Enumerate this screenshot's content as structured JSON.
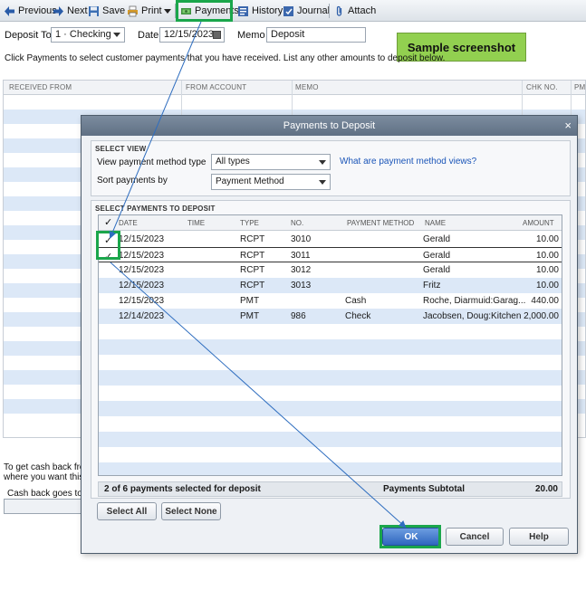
{
  "toolbar": {
    "previous": "Previous",
    "next": "Next",
    "save": "Save",
    "print": "Print",
    "payments": "Payments",
    "history": "History",
    "journal": "Journal",
    "attach": "Attach"
  },
  "deposit": {
    "deposit_to_label": "Deposit To",
    "deposit_to_value": "1 · Checking",
    "date_label": "Date",
    "date_value": "12/15/2023",
    "memo_label": "Memo",
    "memo_value": "Deposit",
    "instructions": "Click Payments to select customer payments that you have received. List any other amounts to deposit below."
  },
  "sample_label": "Sample screenshot",
  "background_table": {
    "columns": [
      "RECEIVED FROM",
      "FROM ACCOUNT",
      "MEMO",
      "CHK NO.",
      "PMT"
    ]
  },
  "bottom": {
    "line1": "To get cash back from",
    "line2": "where you want this m",
    "cash_back": "Cash back goes to"
  },
  "dialog": {
    "title": "Payments to Deposit",
    "select_view": {
      "title": "SELECT VIEW",
      "method_label": "View payment method type",
      "method_value": "All types",
      "sort_label": "Sort payments by",
      "sort_value": "Payment Method",
      "help_link": "What are payment method views?"
    },
    "select_payments": {
      "title": "SELECT PAYMENTS TO DEPOSIT",
      "columns": {
        "check": "✓",
        "date": "DATE",
        "time": "TIME",
        "type": "TYPE",
        "no": "NO.",
        "method": "PAYMENT METHOD",
        "name": "NAME",
        "amount": "AMOUNT"
      },
      "rows": [
        {
          "check": "✓",
          "date": "12/15/2023",
          "type": "RCPT",
          "no": "3010",
          "method": "",
          "name": "Gerald",
          "amount": "10.00"
        },
        {
          "check": "✓",
          "date": "12/15/2023",
          "type": "RCPT",
          "no": "3011",
          "method": "",
          "name": "Gerald",
          "amount": "10.00"
        },
        {
          "check": "",
          "date": "12/15/2023",
          "type": "RCPT",
          "no": "3012",
          "method": "",
          "name": "Gerald",
          "amount": "10.00"
        },
        {
          "check": "",
          "date": "12/15/2023",
          "type": "RCPT",
          "no": "3013",
          "method": "",
          "name": "Fritz",
          "amount": "10.00"
        },
        {
          "check": "",
          "date": "12/15/2023",
          "type": "PMT",
          "no": "",
          "method": "Cash",
          "name": "Roche, Diarmuid:Garag...",
          "amount": "440.00"
        },
        {
          "check": "",
          "date": "12/14/2023",
          "type": "PMT",
          "no": "986",
          "method": "Check",
          "name": "Jacobsen, Doug:Kitchen",
          "amount": "2,000.00"
        }
      ]
    },
    "summary": {
      "selected_text": "2 of 6 payments selected for deposit",
      "subtotal_label": "Payments Subtotal",
      "subtotal_value": "20.00"
    },
    "buttons": {
      "select_all": "Select All",
      "select_none": "Select None",
      "ok": "OK",
      "cancel": "Cancel",
      "help": "Help"
    }
  },
  "colors": {
    "highlight": "#1aa64b",
    "row_alt": "#dce8f7",
    "sample_bg": "#92d050",
    "arrow": "#2e6dbf",
    "ok_button": "#2f66bf"
  }
}
